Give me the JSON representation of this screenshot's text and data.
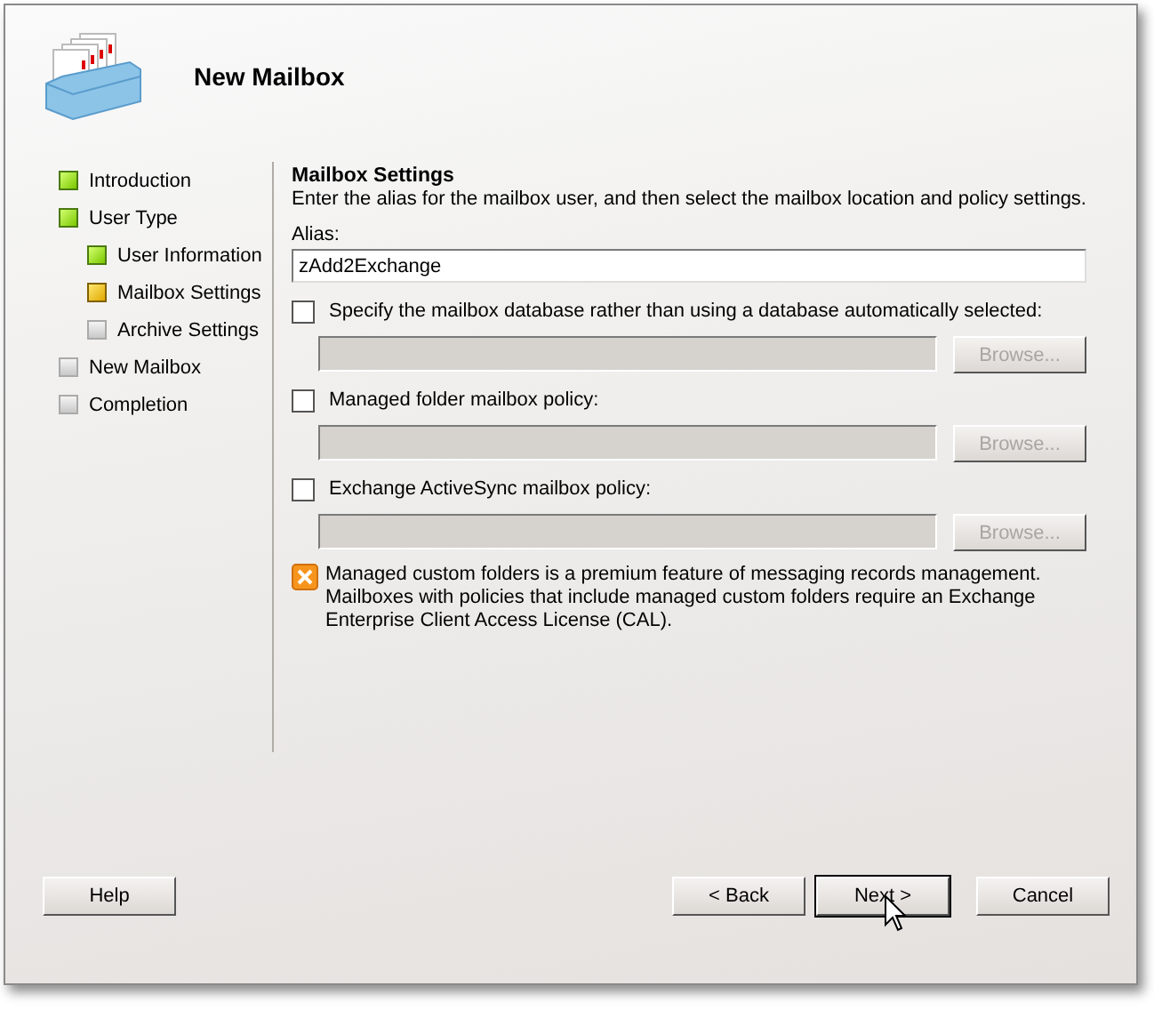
{
  "header": {
    "title": "New Mailbox"
  },
  "steps": [
    {
      "label": "Introduction",
      "completed": true,
      "current": false
    },
    {
      "label": "User Type",
      "completed": true,
      "current": false,
      "children": [
        {
          "label": "User Information",
          "completed": true,
          "current": false
        },
        {
          "label": "Mailbox Settings",
          "completed": false,
          "current": true
        },
        {
          "label": "Archive Settings",
          "completed": false,
          "current": false
        }
      ]
    },
    {
      "label": "New Mailbox",
      "completed": false,
      "current": false
    },
    {
      "label": "Completion",
      "completed": false,
      "current": false
    }
  ],
  "section": {
    "title": "Mailbox Settings",
    "description": "Enter the alias for the mailbox user, and then select the mailbox location and policy settings."
  },
  "alias": {
    "label": "Alias:",
    "value": "zAdd2Exchange"
  },
  "options": [
    {
      "label": "Specify the mailbox database rather than using a database automatically selected:",
      "checked": false,
      "button": "Browse...",
      "disabled": true
    },
    {
      "label": "Managed folder mailbox policy:",
      "checked": false,
      "button": "Browse...",
      "disabled": true
    },
    {
      "label": "Exchange ActiveSync mailbox policy:",
      "checked": false,
      "button": "Browse...",
      "disabled": true
    }
  ],
  "notice": "Managed custom folders is a premium feature of messaging records management. Mailboxes with policies that include managed custom folders require an Exchange Enterprise Client Access License (CAL).",
  "buttons": {
    "help": "Help",
    "back": "< Back",
    "next": "Next >",
    "cancel": "Cancel"
  }
}
